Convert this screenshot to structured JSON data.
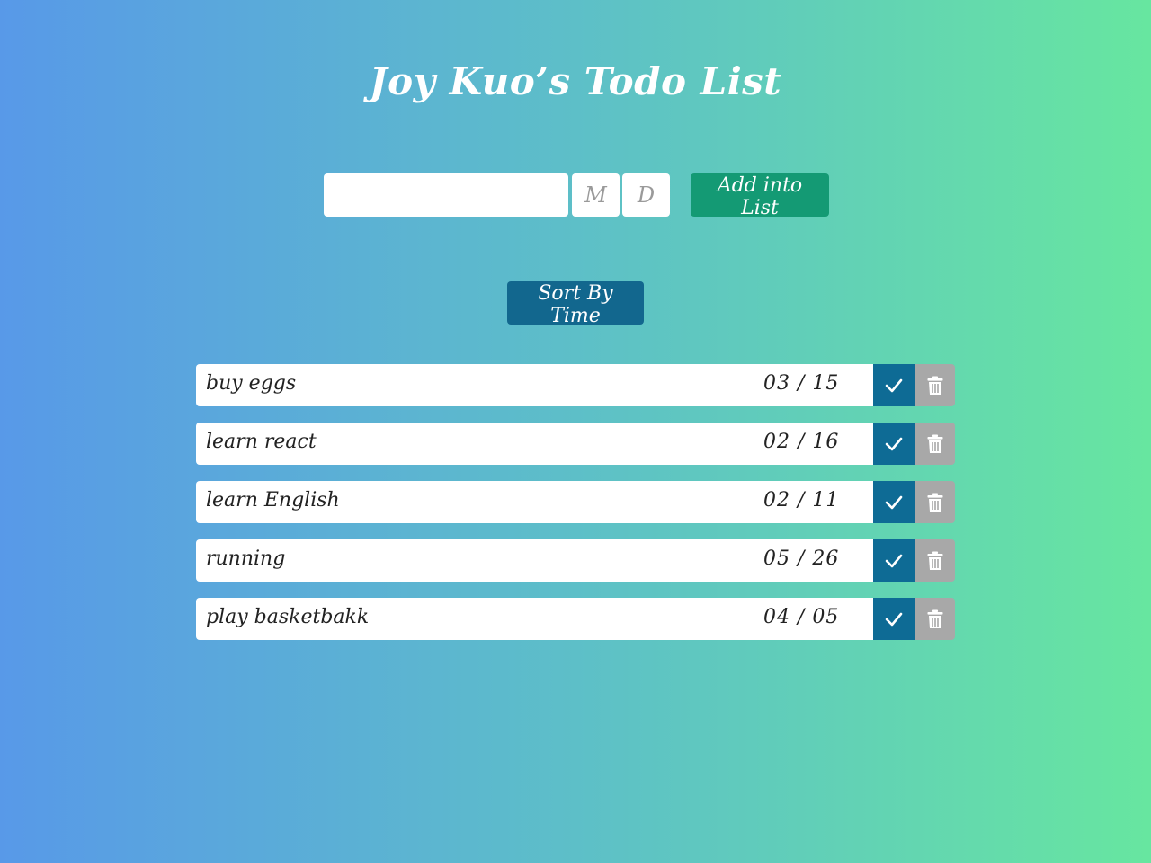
{
  "header": {
    "title": "Joy Kuo’s Todo List"
  },
  "form": {
    "todo_value": "",
    "month_placeholder": "M",
    "day_placeholder": "D",
    "add_label": "Add into List"
  },
  "sort": {
    "label": "Sort By Time"
  },
  "todos": [
    {
      "text": "buy eggs",
      "date": "03 / 15"
    },
    {
      "text": "learn react",
      "date": "02 / 16"
    },
    {
      "text": "learn English",
      "date": "02 / 11"
    },
    {
      "text": "running",
      "date": "05 / 26"
    },
    {
      "text": "play basketbakk",
      "date": "04 / 05"
    }
  ],
  "icons": {
    "done": "check-icon",
    "delete": "trash-icon"
  },
  "colors": {
    "add_button": "#149a74",
    "sort_button": "#12678e",
    "done_button": "#0e6b95",
    "delete_button": "#a8a8a8"
  }
}
